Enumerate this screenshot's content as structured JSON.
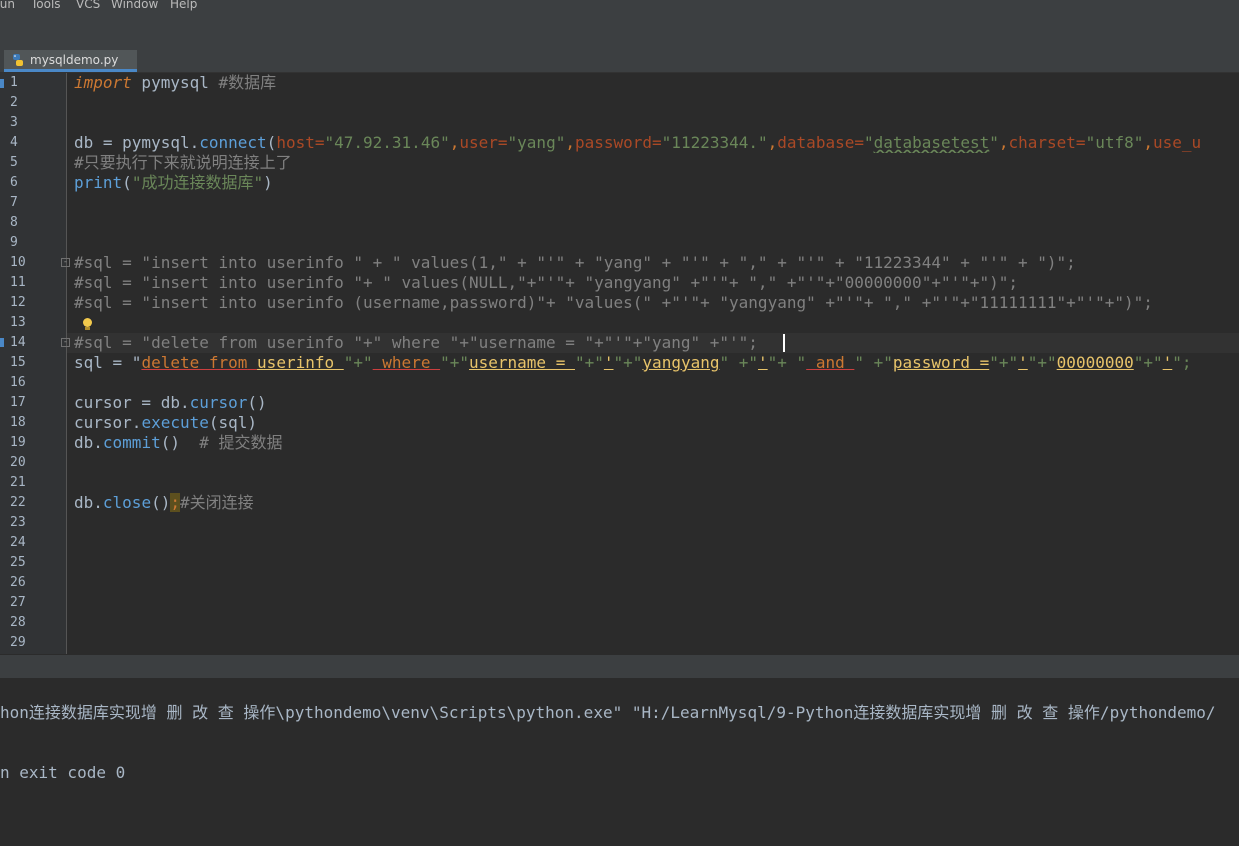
{
  "menu": [
    "Run",
    "Tools",
    "VCS",
    "Window",
    "Help"
  ],
  "menu_display": [
    "Run",
    "Tools",
    "VCS",
    "Window",
    "Help"
  ],
  "tab": {
    "label": "mysqldemo.py",
    "icon": "python-file-icon"
  },
  "line_numbers": [
    "1",
    "2",
    "3",
    "4",
    "5",
    "6",
    "7",
    "8",
    "9",
    "10",
    "11",
    "12",
    "13",
    "14",
    "15",
    "16",
    "17",
    "18",
    "19",
    "20",
    "21",
    "22",
    "23",
    "24",
    "25",
    "26",
    "27",
    "28",
    "29"
  ],
  "code": {
    "l1": {
      "kw": "import",
      "rest": " pymysql ",
      "cmt": "#数据库"
    },
    "l4": {
      "a": "db = pymysql.",
      "fn": "connect",
      "b": "(",
      "p1": "host=",
      "v1": "\"47.92.31.46\"",
      "c1": ",",
      "p2": "user=",
      "v2": "\"yang\"",
      "c2": ",",
      "p3": "password=",
      "v3": "\"11223344.\"",
      "c3": ",",
      "p4": "database=",
      "v4a": "\"",
      "v4b": "databasetest",
      "v4c": "\"",
      "c4": ",",
      "p5": "charset=",
      "v5": "\"utf8\"",
      "c5": ",",
      "p6": "use_u"
    },
    "l5": "#只要执行下来就说明连接上了",
    "l6": {
      "fn": "print",
      "a": "(",
      "s": "\"成功连接数据库\"",
      "b": ")"
    },
    "l10": "#sql = \"insert into userinfo \" + \" values(1,\" + \"'\" + \"yang\" + \"'\" + \",\" + \"'\" + \"11223344\" + \"'\" + \")\";",
    "l11": "#sql = \"insert into userinfo \"+ \" values(NULL,\"+\"'\"+ \"yangyang\" +\"'\"+ \",\" +\"'\"+\"00000000\"+\"'\"+\")\";",
    "l12": "#sql = \"insert into userinfo (username,password)\"+ \"values(\" +\"'\"+ \"yangyang\" +\"'\"+ \",\" +\"'\"+\"11111111\"+\"'\"+\")\";",
    "l14": "#sql = \"delete from userinfo \"+\" where \"+\"username = \"+\"'\"+\"yang\" +\"'\";",
    "l15": {
      "a": "sql = \"",
      "k1": "delete from",
      "sp1": " ",
      "i1": "userinfo ",
      "q1": "\"+\"",
      "k2": " where ",
      "q2": "\"+\"",
      "i2": "username = ",
      "q3": "\"+\"",
      "t1": "'",
      "q4": "\"+\"",
      "i3": "yangyang",
      "q5": "\" +\"",
      "t2": "'",
      "q6": "\"+ \"",
      "k3": " and ",
      "q7": "\" +\"",
      "i4": "password =",
      "q8": "\"+\"",
      "t3": "'",
      "q9": "\"+\"",
      "i5": "00000000",
      "q10": "\"+\"",
      "t4": "'",
      "q11": "\";"
    },
    "l17": {
      "a": "cursor = db.",
      "fn": "cursor",
      "b": "()"
    },
    "l18": {
      "a": "cursor.",
      "fn": "execute",
      "b": "(sql)"
    },
    "l19": {
      "a": "db.",
      "fn": "commit",
      "b": "()  ",
      "cmt": "# 提交数据"
    },
    "l22": {
      "a": "db.",
      "fn": "close",
      "b": "()",
      "semi": ";",
      "cmt": "#关闭连接"
    }
  },
  "console": {
    "line1": "hon连接数据库实现增 删 改 查 操作\\pythondemo\\venv\\Scripts\\python.exe\" \"H:/LearnMysql/9-Python连接数据库实现增 删 改 查 操作/pythondemo/",
    "line2": "n exit code 0"
  },
  "colors": {
    "background": "#2b2b2b",
    "keyword": "#cc7832",
    "string": "#6a8759",
    "comment": "#808080",
    "function": "#5d9fd8",
    "parameter": "#aa4926",
    "accent": "#4a88c7"
  }
}
